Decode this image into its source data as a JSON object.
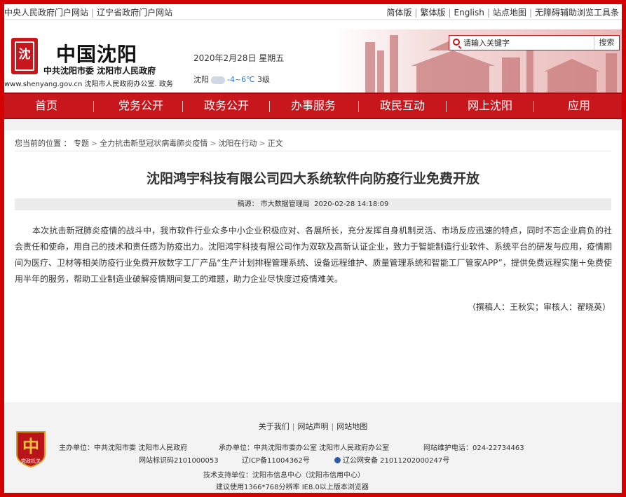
{
  "topbar": {
    "left_links": [
      "中央人民政府门户网站",
      "辽宁省政府门户网站"
    ],
    "right_links": [
      "简体版",
      "繁体版",
      "English",
      "站点地图",
      "无障碍辅助浏览工具条"
    ]
  },
  "header": {
    "logo_glyph": "沈",
    "site_title": "中国沈阳",
    "site_subtitle": "中共沈阳市委   沈阳市人民政府",
    "site_url_line": "www.shenyang.gov.cn 沈阳市人民政府办公室. 政务",
    "date": "2020年2月28日  星期五",
    "weather": {
      "city": "沈阳",
      "temp": "-4~6℃",
      "wind": "3级",
      "icon": "cloud-icon"
    },
    "search": {
      "placeholder": "请输入关键字",
      "button_label": "搜索"
    }
  },
  "nav": {
    "items": [
      "首页",
      "党务公开",
      "政务公开",
      "办事服务",
      "政民互动",
      "网上沈阳",
      "应用"
    ]
  },
  "breadcrumb": {
    "prefix": "您当前的位置 ：",
    "items": [
      "专题",
      "全力抗击新型冠状病毒肺炎疫情",
      "沈阳在行动",
      "正文"
    ]
  },
  "article": {
    "title": "沈阳鸿宇科技有限公司四大系统软件向防疫行业免费开放",
    "source_label": "稿源：",
    "source": "市大数据管理局",
    "datetime": "2020-02-28 14:18:09",
    "body": "本次抗击新冠肺炎疫情的战斗中，我市软件行业众多中小企业积极应对、各展所长，充分发挥自身机制灵活、市场反应迅速的特点，同时不忘企业肩负的社会责任和使命，用自己的技术和责任感为防疫出力。沈阳鸿宇科技有限公司作为双软及高新认证企业，致力于智能制造行业软件、系统平台的研发与应用，疫情期间为医疗、卫材等相关防疫行业免费开放数字工厂产品“生产计划排程管理系统、设备远程维护、质量管理系统和智能工厂管家APP”，提供免费远程实施＋免费使用半年的服务，帮助工业制造业破解疫情期间复工的难题，助力企业尽快度过疫情难关。",
    "author_line": "（撰稿人：王秋实；审核人：翟晓英）"
  },
  "footer": {
    "links": [
      "关于我们",
      "网站声明",
      "网站地图"
    ],
    "logo_text": "党政机关",
    "sponsor": "主办单位：中共沈阳市委   沈阳市人民政府",
    "organizer": "承办单位：中共沈阳市委办公室   沈阳市人民政府办公室",
    "hotline": "网站维护电话：024-22734463",
    "site_id": "网站标识码2101000053",
    "icp": "辽ICP备11004362号",
    "police": "辽公网安备  21011202000247号",
    "tech_support": "技术支持单位：沈阳市信息中心（沈阳市信用中心）",
    "browser_note": "建议使用1366*768分辨率 IE8.0以上版本浏览器"
  },
  "colors": {
    "brand_red": "#c8161d",
    "page_border_red": "#d40000"
  }
}
